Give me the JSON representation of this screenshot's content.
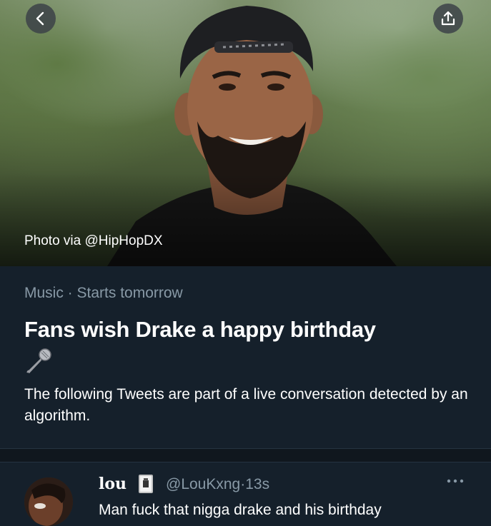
{
  "hero": {
    "photo_credit": "Photo via @HipHopDX"
  },
  "event": {
    "category": "Music",
    "separator": " · ",
    "timing": "Starts tomorrow",
    "title": "Fans wish Drake a happy birthday",
    "description": "The following Tweets are part of a live conversation detected by an algorithm."
  },
  "tweet": {
    "display_name": "lou",
    "handle": "@LouKxng",
    "separator": "·",
    "time": "13s",
    "text": "Man fuck that nigga drake and his birthday"
  },
  "icons": {
    "back": "chevron-left-icon",
    "share": "share-icon",
    "microphone": "microphone-icon",
    "more": "more-icon"
  },
  "colors": {
    "background": "#15202b",
    "secondary_text": "#8899a6",
    "divider": "#10171e"
  }
}
